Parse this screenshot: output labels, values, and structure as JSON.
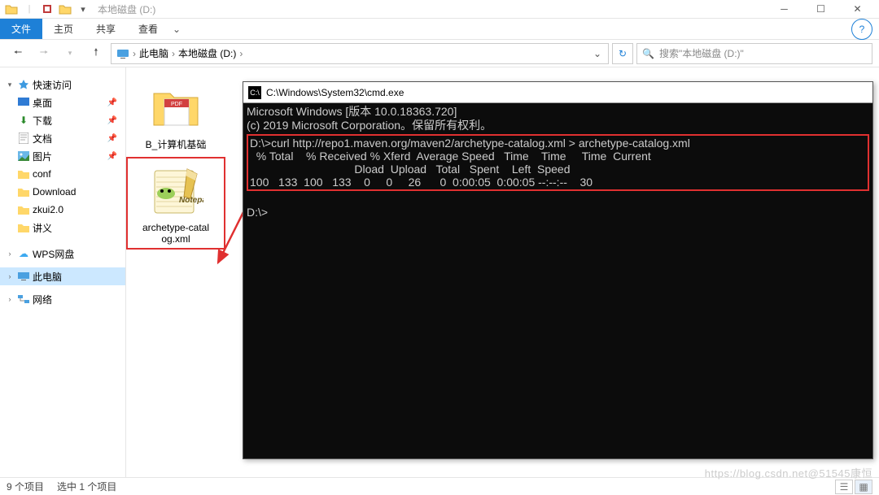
{
  "titlebar": {
    "title": "本地磁盘 (D:)"
  },
  "ribbon": {
    "file": "文件",
    "home": "主页",
    "share": "共享",
    "view": "查看"
  },
  "breadcrumbs": [
    "此电脑",
    "本地磁盘 (D:)"
  ],
  "search": {
    "placeholder": "搜索\"本地磁盘 (D:)\""
  },
  "sidebar": {
    "quick": "快速访问",
    "items": [
      {
        "label": "桌面",
        "pin": true
      },
      {
        "label": "下载",
        "pin": true
      },
      {
        "label": "文档",
        "pin": true
      },
      {
        "label": "图片",
        "pin": true
      },
      {
        "label": "conf",
        "pin": false
      },
      {
        "label": "Download",
        "pin": false
      },
      {
        "label": "zkui2.0",
        "pin": false
      },
      {
        "label": "讲义",
        "pin": false
      }
    ],
    "wps": "WPS网盘",
    "thispc": "此电脑",
    "network": "网络"
  },
  "files": {
    "item1": "B_计算机基础",
    "item2_line1": "archetype-catal",
    "item2_line2": "og.xml"
  },
  "cmd": {
    "title": "C:\\Windows\\System32\\cmd.exe",
    "line1": "Microsoft Windows [版本 10.0.18363.720]",
    "line2": "(c) 2019 Microsoft Corporation。保留所有权利。",
    "hl1": "D:\\>curl http://repo1.maven.org/maven2/archetype-catalog.xml > archetype-catalog.xml",
    "hl2": "  % Total    % Received % Xferd  Average Speed   Time    Time     Time  Current",
    "hl3": "                                 Dload  Upload   Total   Spent    Left  Speed",
    "hl4": "100   133  100   133    0     0     26      0  0:00:05  0:00:05 --:--:--    30",
    "prompt": "D:\\>"
  },
  "status": {
    "count": "9 个项目",
    "selected": "选中 1 个项目"
  },
  "watermark": "https://blog.csdn.net@51545康恒"
}
